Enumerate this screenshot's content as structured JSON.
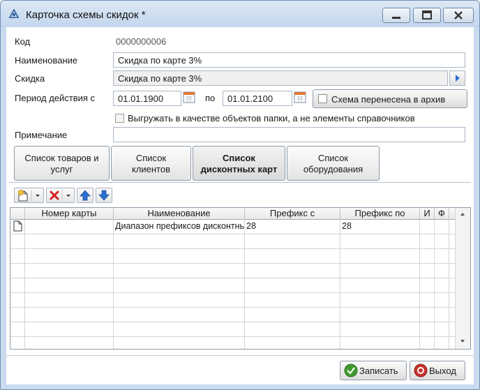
{
  "window": {
    "title": "Карточка схемы скидок *"
  },
  "form": {
    "code_label": "Код",
    "code_value": "0000000006",
    "name_label": "Наименование",
    "name_value": "Скидка по карте 3%",
    "discount_label": "Скидка",
    "discount_value": "Скидка по карте 3%",
    "period_label": "Период действия с",
    "period_from": "01.01.1900",
    "period_to_label": "по",
    "period_to": "01.01.2100",
    "archive_label": "Схема перенесена в архив",
    "export_label": "Выгружать в качестве объектов папки, а не элементы справочников",
    "note_label": "Примечание",
    "note_value": ""
  },
  "tabs": [
    {
      "line1": "Список товаров и",
      "line2": "услуг"
    },
    {
      "line1": "Список",
      "line2": "клиентов"
    },
    {
      "line1": "Список",
      "line2": "дисконтных карт"
    },
    {
      "line1": "Список",
      "line2": "оборудования"
    }
  ],
  "active_tab": 2,
  "table": {
    "headers": [
      "Номер карты",
      "Наименование",
      "Префикс с",
      "Префикс по",
      "И",
      "Ф"
    ],
    "rows": [
      [
        "",
        "Диапазон префиксов дисконтных карт",
        "28",
        "28",
        "",
        ""
      ]
    ]
  },
  "actions": {
    "save_label": "Записать",
    "exit_label": "Выход"
  },
  "colors": {
    "accent": "#2a6fd1",
    "delete": "#d62020",
    "save_icon": "#3f9a2e",
    "exit_icon": "#c8322c"
  }
}
